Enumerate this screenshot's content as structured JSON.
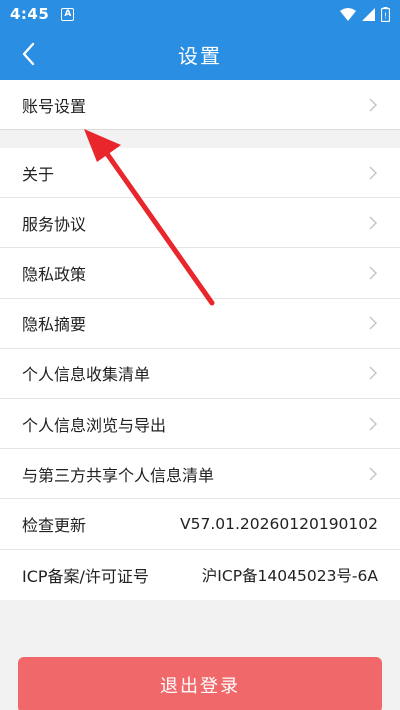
{
  "status_bar": {
    "time": "4:45",
    "notif_glyph": "A"
  },
  "header": {
    "title": "设置",
    "back_icon": "chevron-left-icon"
  },
  "group_1": [
    {
      "label": "账号设置"
    }
  ],
  "group_2": [
    {
      "label": "关于"
    },
    {
      "label": "服务协议"
    },
    {
      "label": "隐私政策"
    },
    {
      "label": "隐私摘要"
    },
    {
      "label": "个人信息收集清单"
    },
    {
      "label": "个人信息浏览与导出"
    },
    {
      "label": "与第三方共享个人信息清单"
    },
    {
      "label": "检查更新",
      "value": "V57.01.20260120190102"
    },
    {
      "label": "ICP备案/许可证号",
      "value": "沪ICP备14045023号-6A"
    }
  ],
  "logout_label": "退出登录",
  "colors": {
    "accent": "#2a8fe3",
    "logout": "#f06869",
    "arrow": "#e8262b"
  }
}
